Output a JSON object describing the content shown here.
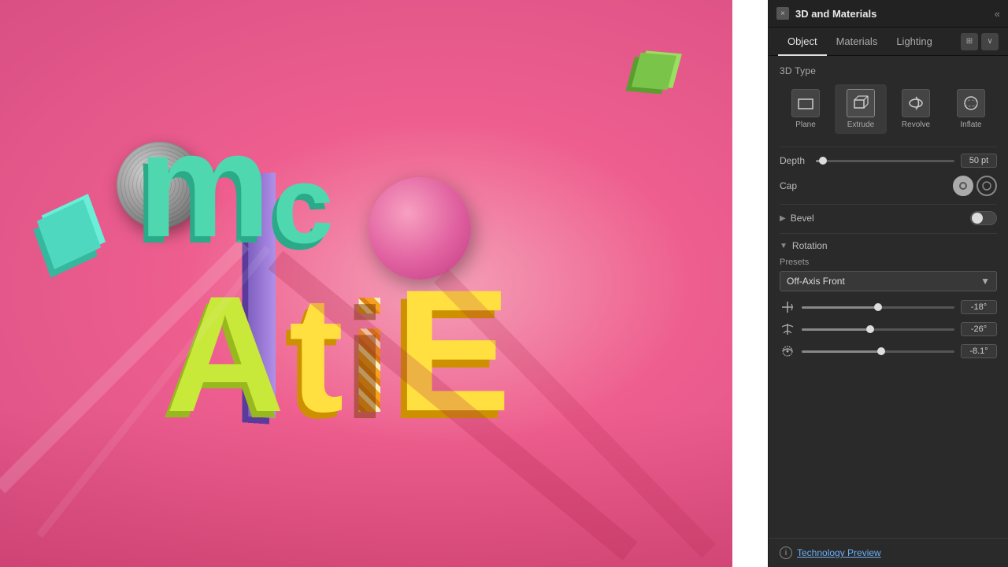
{
  "canvas": {
    "bg_color": "#ee6090"
  },
  "panel": {
    "title": "3D and Materials",
    "close_label": "×",
    "collapse_label": "«",
    "tabs": [
      {
        "id": "object",
        "label": "Object",
        "active": true
      },
      {
        "id": "materials",
        "label": "Materials",
        "active": false
      },
      {
        "id": "lighting",
        "label": "Lighting",
        "active": false
      }
    ],
    "type_section": {
      "label": "3D Type",
      "options": [
        {
          "id": "plane",
          "label": "Plane",
          "active": false,
          "icon": "▣"
        },
        {
          "id": "extrude",
          "label": "Extrude",
          "active": true,
          "icon": "⬡"
        },
        {
          "id": "revolve",
          "label": "Revolve",
          "active": false,
          "icon": "◎"
        },
        {
          "id": "inflate",
          "label": "Inflate",
          "active": false,
          "icon": "⬤"
        }
      ]
    },
    "depth": {
      "label": "Depth",
      "value": "50 pt",
      "fill_pct": 5
    },
    "cap": {
      "label": "Cap",
      "btn1_filled": true,
      "btn2_filled": false
    },
    "bevel": {
      "label": "Bevel",
      "expanded": false,
      "toggle_on": false
    },
    "rotation": {
      "label": "Rotation",
      "expanded": true,
      "presets_label": "Presets",
      "preset_value": "Off-Axis Front",
      "axes": [
        {
          "id": "x",
          "value": "-18°",
          "fill_pct": 50
        },
        {
          "id": "y",
          "value": "-26°",
          "fill_pct": 45
        },
        {
          "id": "z",
          "value": "-8.1°",
          "fill_pct": 52
        }
      ]
    },
    "tech_preview": {
      "label": "Technology Preview",
      "info_icon": "i"
    }
  }
}
